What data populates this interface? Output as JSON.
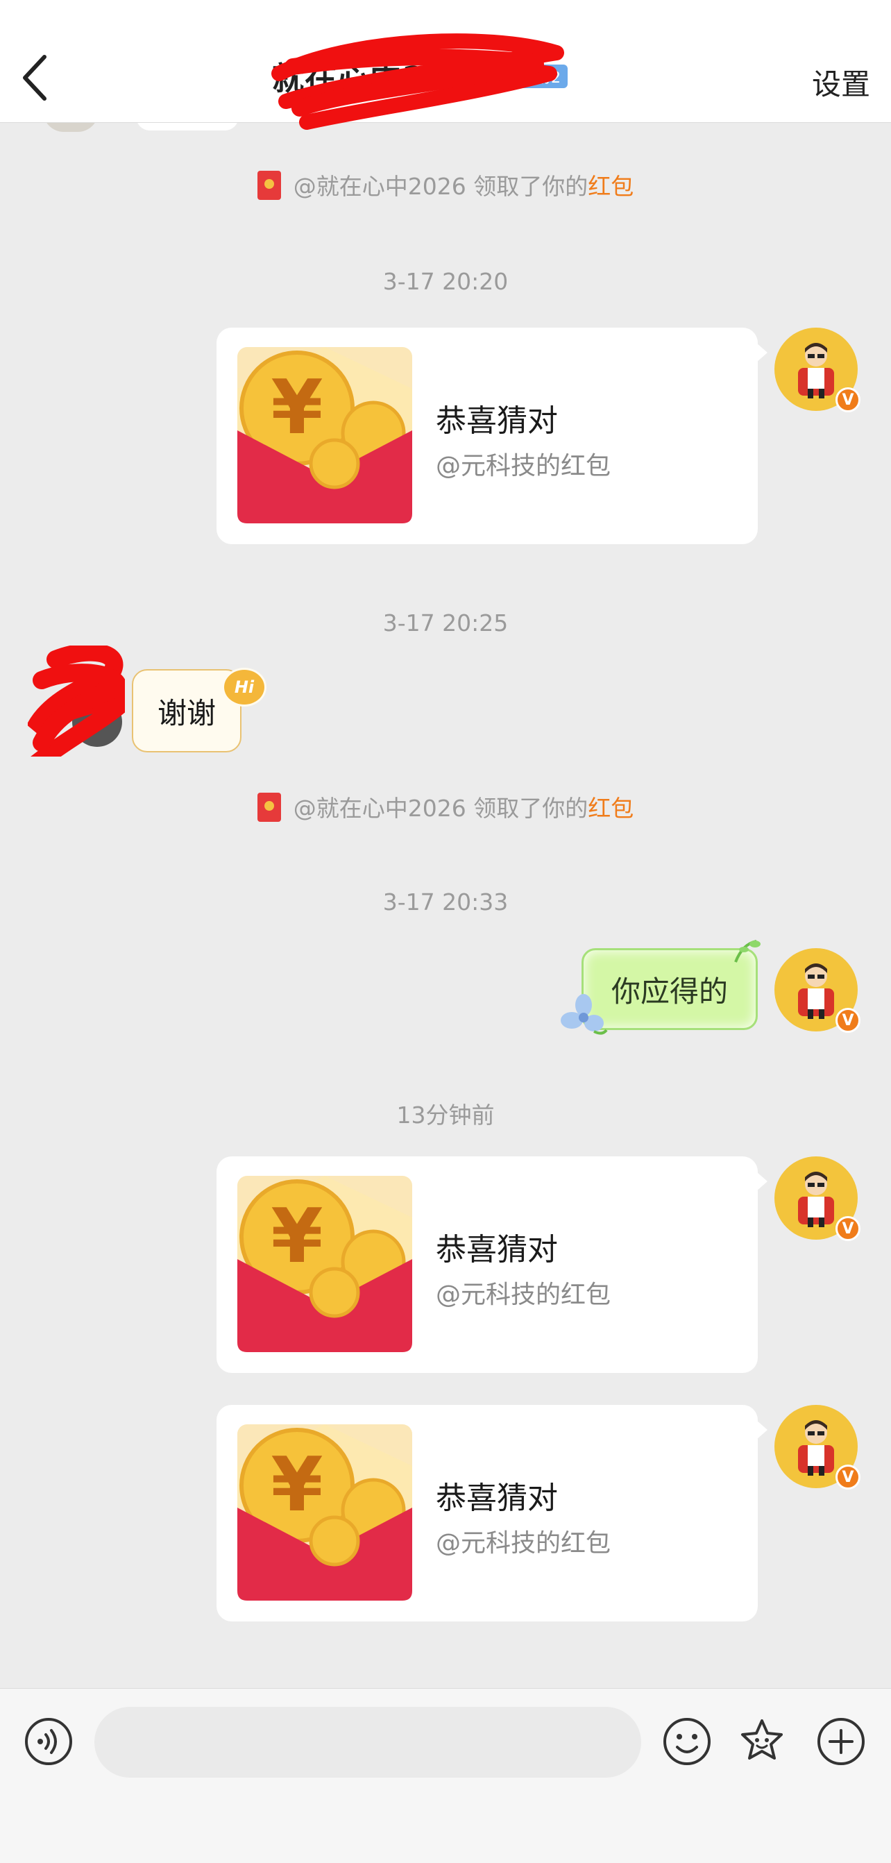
{
  "header": {
    "title": "就在心中2026",
    "fan_badge": "铁粉2",
    "settings_label": "设置"
  },
  "messages": {
    "notice_1": {
      "prefix": "@就在心中2026 领取了你的",
      "highlight": "红包"
    },
    "time_1": "3-17 20:20",
    "packet_1": {
      "title": "恭喜猜对",
      "subtitle": "@元科技的红包"
    },
    "time_2": "3-17 20:25",
    "thanks_text": "谢谢",
    "hi_tag": "Hi",
    "notice_2": {
      "prefix": "@就在心中2026 领取了你的",
      "highlight": "红包"
    },
    "time_3": "3-17 20:33",
    "reply_text": "你应得的",
    "time_4": "13分钟前",
    "packet_2": {
      "title": "恭喜猜对",
      "subtitle": "@元科技的红包"
    },
    "packet_3": {
      "title": "恭喜猜对",
      "subtitle": "@元科技的红包"
    },
    "verified_mark": "V"
  },
  "colors": {
    "background": "#ececec",
    "highlight_orange": "#f07c1a",
    "packet_red": "#e22b48",
    "coin_gold": "#f6c23a",
    "fan_badge_blue": "#6ba9ea",
    "reply_bubble_green": "#d4f7a6"
  },
  "icons": {
    "back": "chevron-left-icon",
    "voice": "voice-icon",
    "emoji": "emoji-icon",
    "sticker": "sticker-icon",
    "plus": "plus-icon"
  }
}
